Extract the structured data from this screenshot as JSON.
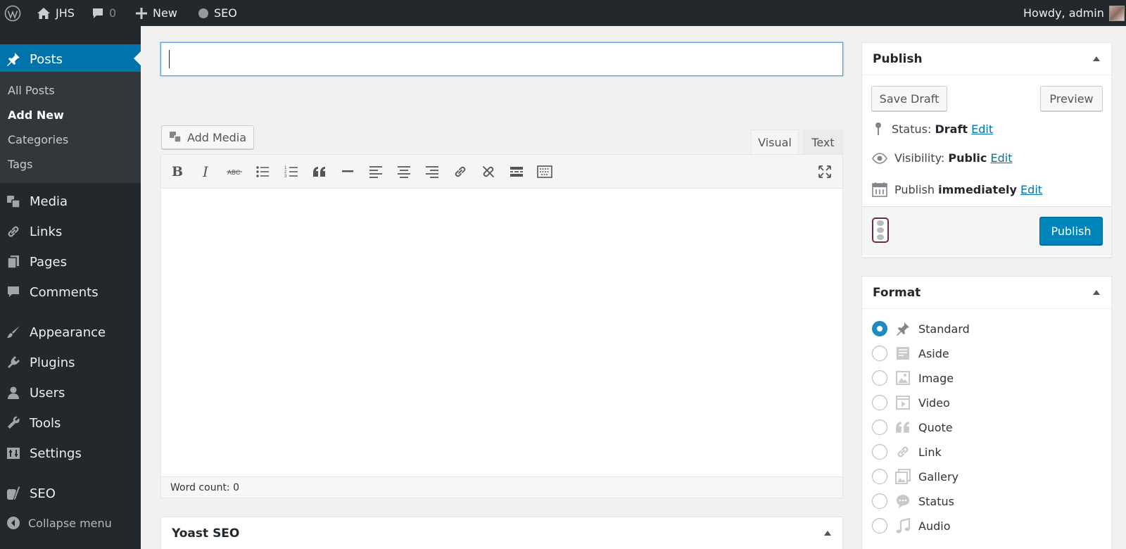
{
  "adminbar": {
    "site_name": "JHS",
    "comments_count": "0",
    "new_label": "New",
    "seo_label": "SEO",
    "howdy": "Howdy, admin"
  },
  "sidebar": {
    "items": [
      {
        "label": "Posts",
        "icon": "pin-icon",
        "current": true
      },
      {
        "label": "Media",
        "icon": "media-icon"
      },
      {
        "label": "Links",
        "icon": "link-icon"
      },
      {
        "label": "Pages",
        "icon": "pages-icon"
      },
      {
        "label": "Comments",
        "icon": "comment-icon"
      },
      {
        "label": "Appearance",
        "icon": "brush-icon"
      },
      {
        "label": "Plugins",
        "icon": "plug-icon"
      },
      {
        "label": "Users",
        "icon": "user-icon"
      },
      {
        "label": "Tools",
        "icon": "wrench-icon"
      },
      {
        "label": "Settings",
        "icon": "settings-icon"
      },
      {
        "label": "SEO",
        "icon": "yoast-icon"
      }
    ],
    "submenu": [
      "All Posts",
      "Add New",
      "Categories",
      "Tags"
    ],
    "collapse_label": "Collapse menu"
  },
  "editor": {
    "title_value": "",
    "add_media_label": "Add Media",
    "tabs": [
      "Visual",
      "Text"
    ],
    "word_count": "Word count: 0"
  },
  "publish": {
    "title": "Publish",
    "save_draft": "Save Draft",
    "preview": "Preview",
    "status_label": "Status:",
    "status_value": "Draft",
    "visibility_label": "Visibility:",
    "visibility_value": "Public",
    "schedule_label": "Publish",
    "schedule_value": "immediately",
    "edit_label": "Edit",
    "publish_button": "Publish"
  },
  "format": {
    "title": "Format",
    "options": [
      "Standard",
      "Aside",
      "Image",
      "Video",
      "Quote",
      "Link",
      "Gallery",
      "Status",
      "Audio"
    ],
    "selected": "Standard"
  },
  "yoast": {
    "title": "Yoast SEO"
  },
  "colors": {
    "admin_dark": "#23282d",
    "accent_blue": "#0073aa",
    "publish_blue": "#0085ba"
  }
}
